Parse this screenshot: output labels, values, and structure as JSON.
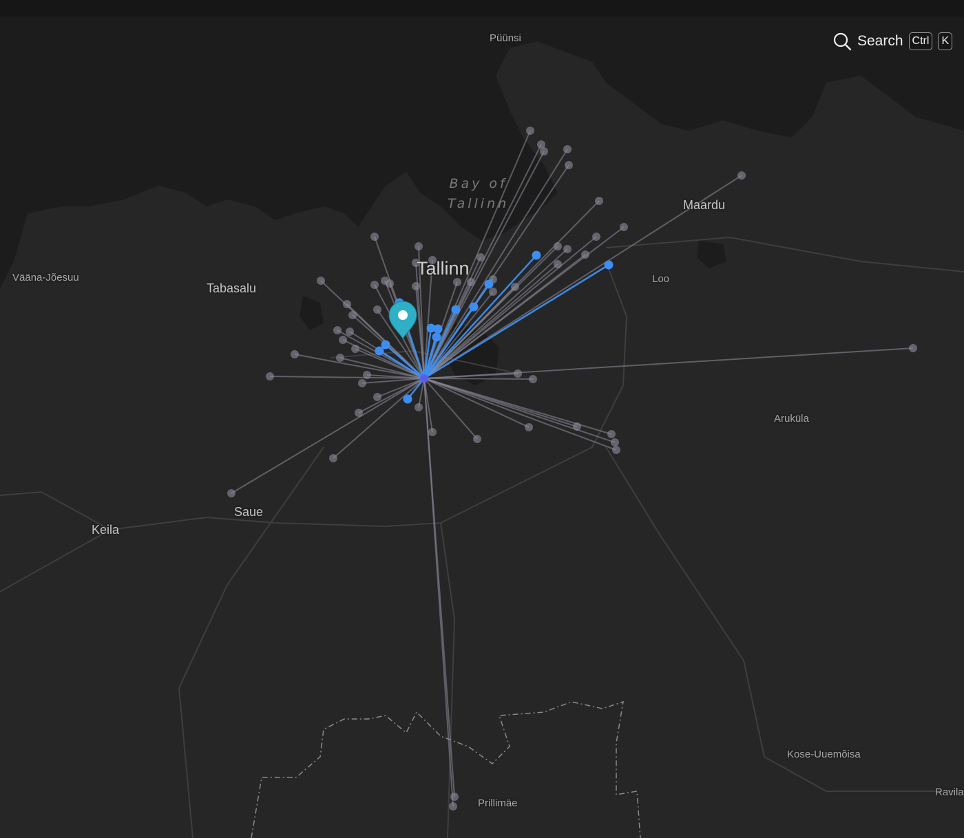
{
  "search": {
    "label": "Search",
    "keys": [
      "Ctrl",
      "K"
    ]
  },
  "places": {
    "puunsi": "Püünsi",
    "bay_line1": "Bay of",
    "bay_line2": "Tallinn",
    "maardu": "Maardu",
    "tallinn": "Tallinn",
    "vaana": "Vääna-Jõesuu",
    "tabasalu": "Tabasalu",
    "loo": "Loo",
    "arukula": "Aruküla",
    "saue": "Saue",
    "keila": "Keila",
    "kose": "Kose-Uuemõisa",
    "prillimae": "Prillimäe",
    "ravila": "Ravila"
  },
  "colors": {
    "land": "#262626",
    "water": "#1b1b1b",
    "line_grey": "#8e8e9c",
    "line_blue": "#3d8ef0",
    "hub": "#5b5bf0",
    "pin": "#2fb0c7"
  },
  "map": {
    "hub_name": "hub-dot",
    "pin_name": "selected-location-pin"
  }
}
